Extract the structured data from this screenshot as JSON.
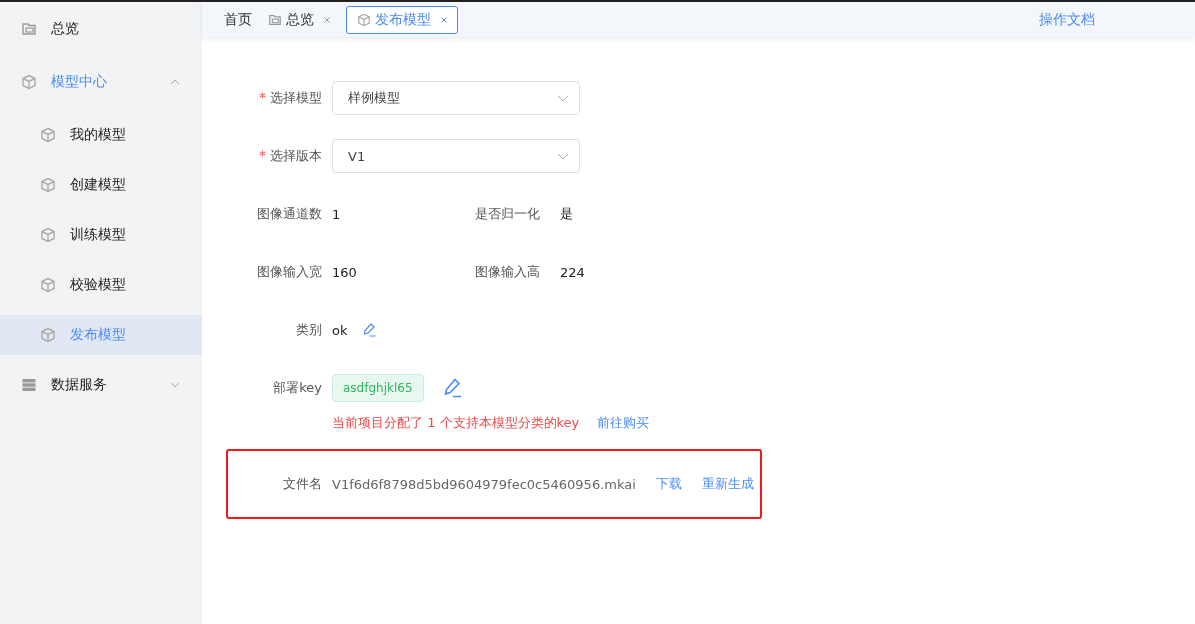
{
  "sidebar": {
    "items": [
      {
        "label": "总览",
        "selected": false
      },
      {
        "label": "模型中心",
        "selected": false,
        "expanded": true,
        "children": [
          {
            "label": "我的模型",
            "selected": false
          },
          {
            "label": "创建模型",
            "selected": false
          },
          {
            "label": "训练模型",
            "selected": false
          },
          {
            "label": "校验模型",
            "selected": false
          },
          {
            "label": "发布模型",
            "selected": true
          }
        ]
      },
      {
        "label": "数据服务",
        "selected": false,
        "expanded": false
      }
    ]
  },
  "tabs": [
    {
      "label": "首页",
      "selected": false,
      "closable": false
    },
    {
      "label": "总览",
      "selected": false,
      "closable": true
    },
    {
      "label": "发布模型",
      "selected": true,
      "closable": true
    }
  ],
  "header_link": "操作文档",
  "form": {
    "selects": [
      {
        "label": "选择模型",
        "required": true,
        "value": "样例模型"
      },
      {
        "label": "选择版本",
        "required": true,
        "value": "V1"
      }
    ],
    "info_rows": [
      [
        {
          "label": "图像通道数",
          "value": "1"
        },
        {
          "label": "是否归一化",
          "value": "是"
        }
      ],
      [
        {
          "label": "图像输入宽",
          "value": "160"
        },
        {
          "label": "图像输入高",
          "value": "224"
        }
      ]
    ],
    "category": {
      "label": "类别",
      "value": "ok"
    },
    "deploy_key": {
      "label": "部署key",
      "tag": "asdfghjkl65",
      "hint": "当前项目分配了 1 个支持本模型分类的key",
      "link": "前往购买"
    },
    "file": {
      "label": "文件名",
      "value": "V1f6d6f8798d5bd9604979fec0c5460956.mkai",
      "highlighted": true,
      "actions": [
        "下载",
        "重新生成"
      ]
    }
  }
}
